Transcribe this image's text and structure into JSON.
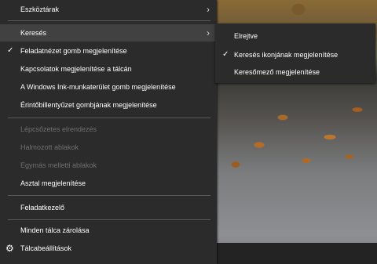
{
  "context_menu": {
    "items": [
      {
        "label": "Eszköztárak",
        "has_submenu": true
      },
      {
        "label": "Keresés",
        "has_submenu": true,
        "highlighted": true
      },
      {
        "label": "Feladatnézet gomb megjelenítése",
        "checked": true
      },
      {
        "label": "Kapcsolatok megjelenítése a tálcán"
      },
      {
        "label": "A Windows Ink-munkaterület gomb megjelenítése"
      },
      {
        "label": "Érintőbillentyűzet gombjának megjelenítése"
      },
      {
        "label": "Lépcsőzetes elrendezés",
        "disabled": true
      },
      {
        "label": "Halmozott ablakok",
        "disabled": true
      },
      {
        "label": "Egymás melletti ablakok",
        "disabled": true
      },
      {
        "label": "Asztal megjelenítése"
      },
      {
        "label": "Feladatkezelő"
      },
      {
        "label": "Minden tálca zárolása"
      },
      {
        "label": "Tálcabeállítások",
        "icon": "gear-icon"
      }
    ]
  },
  "search_submenu": {
    "items": [
      {
        "label": "Elrejtve"
      },
      {
        "label": "Keresés ikonjának megjelenítése",
        "checked": true
      },
      {
        "label": "Keresőmező megjelenítése"
      }
    ]
  },
  "glyphs": {
    "arrow": "›",
    "check": "✓",
    "gear": "⚙"
  },
  "colors": {
    "menu_bg": "#2b2b2b",
    "hover_bg": "#414141",
    "disabled_text": "#6f6f6f"
  }
}
